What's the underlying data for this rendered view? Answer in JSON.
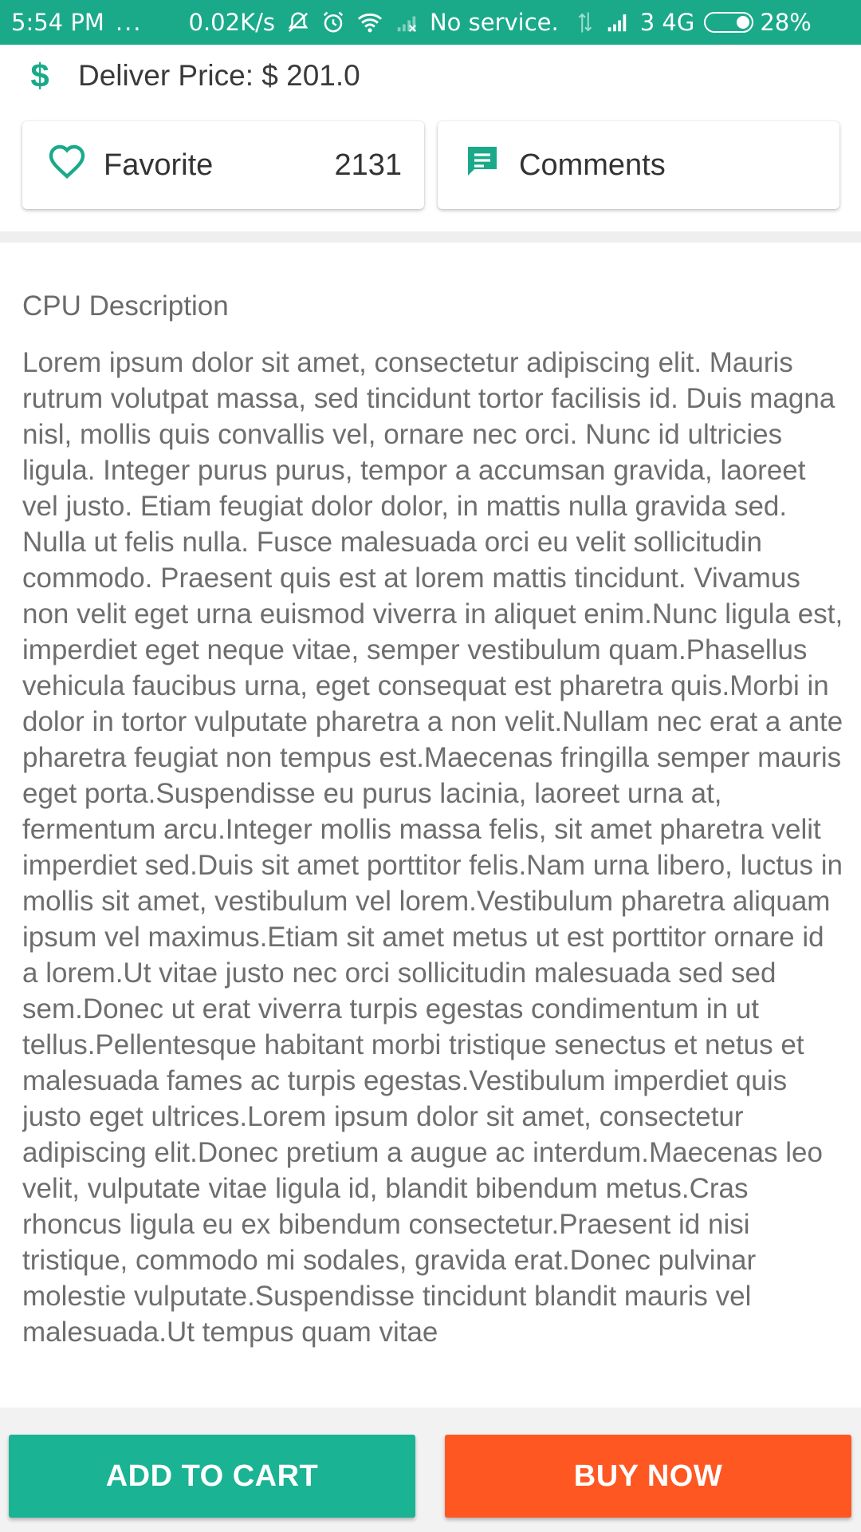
{
  "colors": {
    "accent": "#1aaa8a",
    "add_to_cart": "#1ab394",
    "buy_now": "#ff5722"
  },
  "status_bar": {
    "time": "5:54 PM",
    "dots": "...",
    "speed": "0.02K/s",
    "no_service": "No service.",
    "network": "3 4G",
    "battery": "28%",
    "icons": [
      "mute-icon",
      "alarm-icon",
      "wifi-icon",
      "signal-off-icon",
      "data-arrows-icon",
      "signal-icon",
      "battery-icon"
    ]
  },
  "price": {
    "icon": "dollar-icon",
    "label": "Deliver Price: $ 201.0"
  },
  "favorite": {
    "icon": "heart-outline-icon",
    "label": "Favorite",
    "count": "2131"
  },
  "comments": {
    "icon": "comment-icon",
    "label": "Comments"
  },
  "description": {
    "title": "CPU Description",
    "body": "Lorem ipsum dolor sit amet, consectetur adipiscing elit. Mauris rutrum volutpat massa, sed tincidunt tortor facilisis id. Duis magna nisl, mollis quis convallis vel, ornare nec orci. Nunc id ultricies ligula. Integer purus purus, tempor a accumsan gravida, laoreet vel justo. Etiam feugiat dolor dolor, in mattis nulla gravida sed. Nulla ut felis nulla. Fusce malesuada orci eu velit sollicitudin commodo. Praesent quis est at lorem mattis tincidunt. Vivamus non velit eget urna euismod viverra in aliquet enim.Nunc ligula est, imperdiet eget neque vitae, semper vestibulum quam.Phasellus vehicula faucibus urna, eget consequat est pharetra quis.Morbi in dolor in tortor vulputate pharetra a non velit.Nullam nec erat a ante pharetra feugiat non tempus est.Maecenas fringilla semper mauris eget porta.Suspendisse eu purus lacinia, laoreet urna at, fermentum arcu.Integer mollis massa felis, sit amet pharetra velit imperdiet sed.Duis sit amet porttitor felis.Nam urna libero, luctus in mollis sit amet, vestibulum vel lorem.Vestibulum pharetra aliquam ipsum vel maximus.Etiam sit amet metus ut est porttitor ornare id a lorem.Ut vitae justo nec orci sollicitudin malesuada sed sed sem.Donec ut erat viverra turpis egestas condimentum in ut tellus.Pellentesque habitant morbi tristique senectus et netus et malesuada fames ac turpis egestas.Vestibulum imperdiet quis justo eget ultrices.Lorem ipsum dolor sit amet, consectetur adipiscing elit.Donec pretium a augue ac interdum.Maecenas leo velit, vulputate vitae ligula id, blandit bibendum metus.Cras rhoncus ligula eu ex bibendum consectetur.Praesent id nisi tristique, commodo mi sodales, gravida erat.Donec pulvinar molestie vulputate.Suspendisse tincidunt blandit mauris vel malesuada.Ut tempus quam vitae"
  },
  "actions": {
    "add_to_cart": "ADD TO CART",
    "buy_now": "BUY NOW"
  }
}
